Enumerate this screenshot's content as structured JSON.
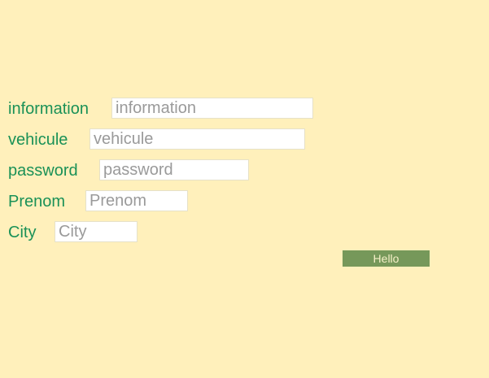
{
  "form": {
    "fields": [
      {
        "label": "information",
        "placeholder": "information",
        "value": ""
      },
      {
        "label": "vehicule",
        "placeholder": "vehicule",
        "value": ""
      },
      {
        "label": "password",
        "placeholder": "password",
        "value": ""
      },
      {
        "label": "Prenom",
        "placeholder": "Prenom",
        "value": ""
      },
      {
        "label": "City",
        "placeholder": "City",
        "value": ""
      }
    ],
    "submit_label": "Hello"
  },
  "colors": {
    "background": "#fff0bb",
    "label": "#1a9157",
    "button_bg": "#76985a",
    "button_text": "#f6f0c8"
  }
}
